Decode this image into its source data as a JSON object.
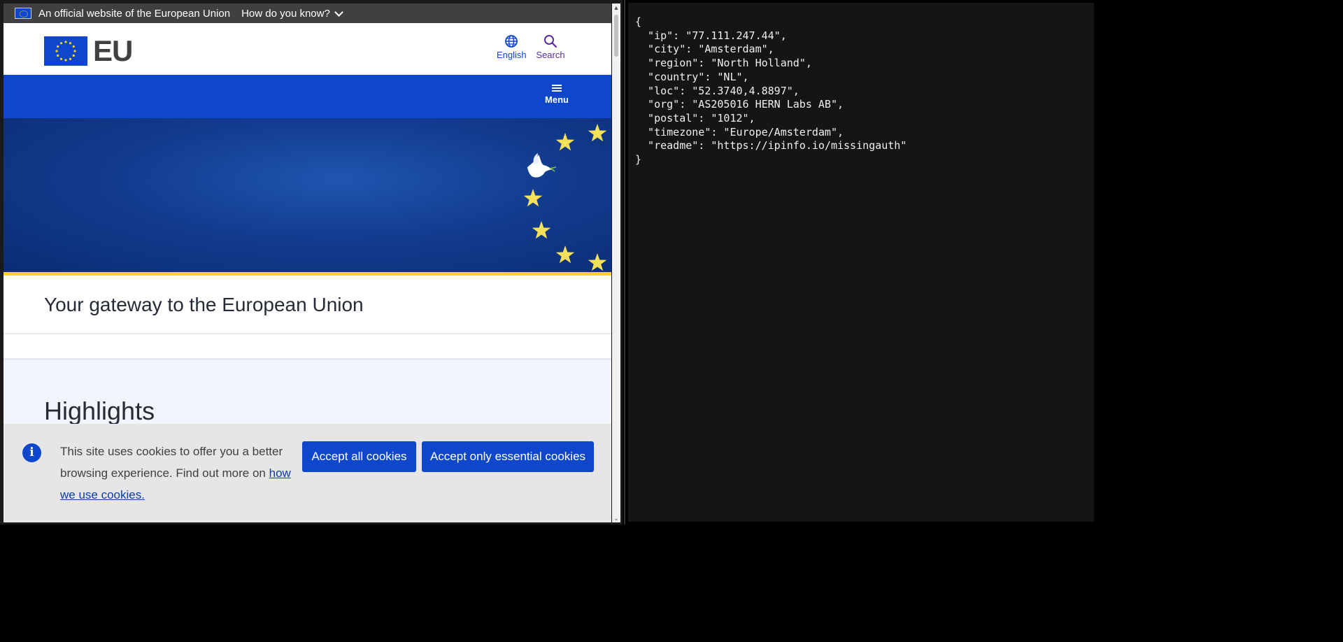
{
  "browser": {
    "official_banner": {
      "text": "An official website of the European Union",
      "how_know": "How do you know?"
    },
    "header": {
      "logo_text": "EU",
      "language_label": "English",
      "search_label": "Search"
    },
    "nav": {
      "menu_label": "Menu"
    },
    "page_title": "Your gateway to the European Union",
    "highlights_title": "Highlights",
    "cookie_banner": {
      "text_before_link": "This site uses cookies to offer you a better browsing experience. Find out more on ",
      "link_text": "how we use cookies.",
      "accept_all": "Accept all cookies",
      "accept_essential": "Accept only essential cookies"
    }
  },
  "json_panel": {
    "open_brace": "{",
    "lines": [
      "  \"ip\": \"77.111.247.44\",",
      "  \"city\": \"Amsterdam\",",
      "  \"region\": \"North Holland\",",
      "  \"country\": \"NL\",",
      "  \"loc\": \"52.3740,4.8897\",",
      "  \"org\": \"AS205016 HERN Labs AB\",",
      "  \"postal\": \"1012\",",
      "  \"timezone\": \"Europe/Amsterdam\",",
      "  \"readme\": \"https://ipinfo.io/missingauth\""
    ],
    "close_brace": "}"
  },
  "colors": {
    "eu_blue": "#0e47cb",
    "eu_yellow": "#ffd617",
    "banner_grey": "#404040",
    "terminal_bg": "#151515"
  }
}
